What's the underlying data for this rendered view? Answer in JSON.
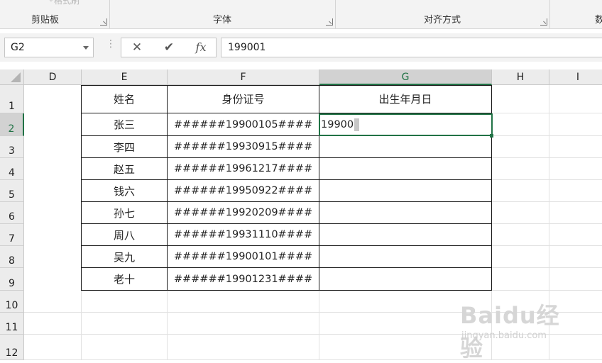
{
  "ribbon": {
    "cut_label": "格式刷",
    "groups": [
      {
        "label": "剪贴板"
      },
      {
        "label": "字体"
      },
      {
        "label": "对齐方式"
      },
      {
        "label": "数"
      }
    ]
  },
  "formula_bar": {
    "name_box": "G2",
    "cancel_symbol": "✕",
    "enter_symbol": "✔",
    "fx_symbol": "fx",
    "content": "199001"
  },
  "columns": [
    {
      "label": "D"
    },
    {
      "label": "E"
    },
    {
      "label": "F"
    },
    {
      "label": "G",
      "selected": true
    },
    {
      "label": "H"
    },
    {
      "label": "I"
    }
  ],
  "rows": [
    "1",
    "2",
    "3",
    "4",
    "5",
    "6",
    "7",
    "8",
    "9",
    "10",
    "11",
    "12"
  ],
  "table": {
    "headers": [
      "姓名",
      "身份证号",
      "出生年月日"
    ],
    "records": [
      {
        "name": "张三",
        "id": "######19900105####"
      },
      {
        "name": "李四",
        "id": "######19930915####"
      },
      {
        "name": "赵五",
        "id": "######19961217####"
      },
      {
        "name": "钱六",
        "id": "######19950922####"
      },
      {
        "name": "孙七",
        "id": "######19920209####"
      },
      {
        "name": "周八",
        "id": "######19931110####"
      },
      {
        "name": "吴九",
        "id": "######19900101####"
      },
      {
        "name": "老十",
        "id": "######19901231####"
      }
    ]
  },
  "active_cell": {
    "ref": "G2",
    "value": "199001"
  },
  "watermark": {
    "logo": "Baidu经验",
    "url": "jingyan.baidu.com"
  },
  "colors": {
    "accent": "#217346"
  }
}
